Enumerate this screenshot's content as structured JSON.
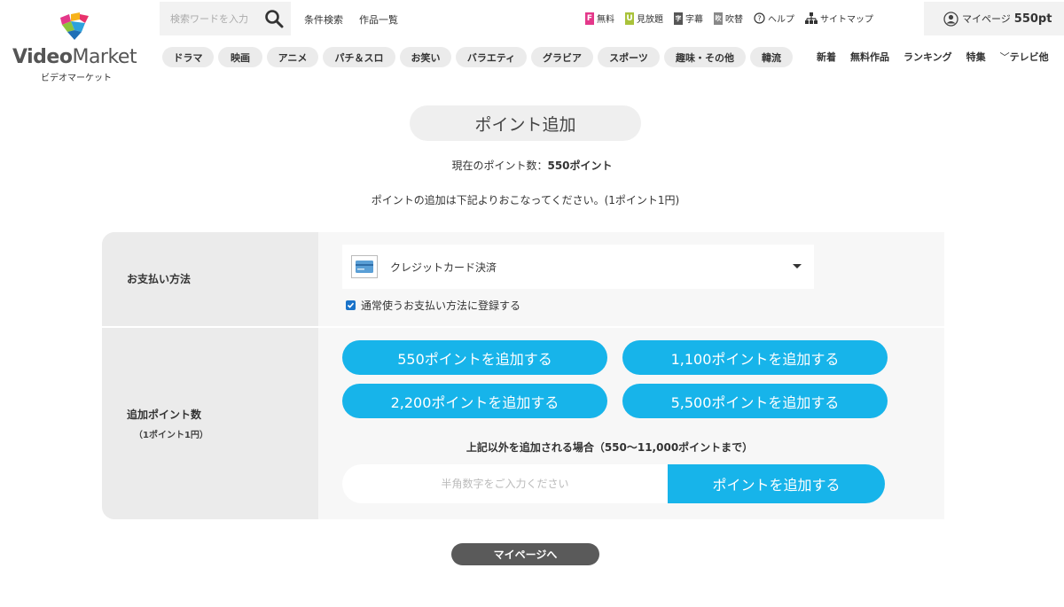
{
  "logo": {
    "brand_bold": "Video",
    "brand_light": "Market",
    "sub": "ビデオマーケット"
  },
  "header": {
    "search_placeholder": "検索ワードを入力",
    "condition_search": "条件検索",
    "title_list": "作品一覧",
    "free": {
      "badge": "F",
      "label": "無料",
      "color": "#e4388a"
    },
    "unlimited": {
      "badge": "U",
      "label": "見放題",
      "color": "#a9c23a"
    },
    "subtitle": {
      "badge": "字",
      "label": "字幕",
      "color": "#555555"
    },
    "dubbed": {
      "badge": "吹",
      "label": "吹替",
      "color": "#888888"
    },
    "help": "ヘルプ",
    "sitemap": "サイトマップ",
    "mypage": "マイページ",
    "points": "550pt"
  },
  "genres": [
    "ドラマ",
    "映画",
    "アニメ",
    "パチ＆スロ",
    "お笑い",
    "バラエティ",
    "グラビア",
    "スポーツ",
    "趣味・その他",
    "韓流"
  ],
  "right_nav": [
    "新着",
    "無料作品",
    "ランキング",
    "特集",
    "テレビ他"
  ],
  "main": {
    "title": "ポイント追加",
    "current_label": "現在のポイント数：",
    "current_value": "550ポイント",
    "notice": "ポイントの追加は下記よりおこなってください。(1ポイント1円)"
  },
  "form": {
    "payment_label": "お支払い方法",
    "payment_method": "クレジットカード決済",
    "register_default": "通常使うお支払い方法に登録する",
    "points_label": "追加ポイント数",
    "points_sub": "（1ポイント1円）",
    "buttons": [
      "550ポイントを追加する",
      "1,100ポイントを追加する",
      "2,200ポイントを追加する",
      "5,500ポイントを追加する"
    ],
    "other_label": "上記以外を追加される場合（550〜11,000ポイントまで）",
    "custom_placeholder": "半角数字をご入力ください",
    "custom_button": "ポイントを追加する"
  },
  "footer": {
    "mypage_button": "マイページへ"
  },
  "colors": {
    "accent": "#17b4ea",
    "panel": "#f7f7f7",
    "label_col": "#ebebeb"
  }
}
